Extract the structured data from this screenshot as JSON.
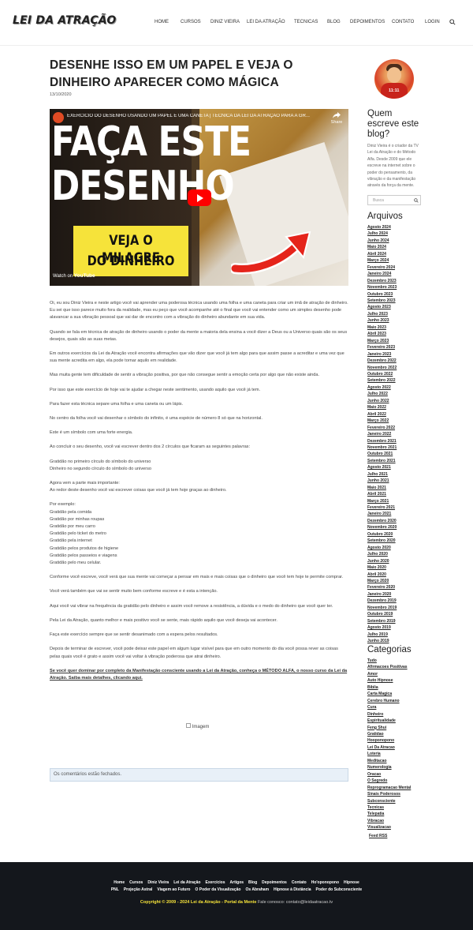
{
  "header": {
    "logo": "LEI DA ATRAÇÃO",
    "nav": [
      "Home",
      "CURSOS",
      "DINIZ VIEIRA",
      "LEI DA ATRAÇÃO",
      "TECNICAS",
      "BLOG",
      "DEPOIMENTOS",
      "CONTATO",
      "LOGIN"
    ]
  },
  "post": {
    "title": "DESENHE ISSO EM UM PAPEL E VEJA O DINHEIRO APARECER COMO MÁGICA",
    "date": "13/10/2020",
    "video": {
      "title": "EXERCÍCIO DO DESENHO USANDO UM PAPEL E UMA CANETA | TÉCNICA DA LEI DA ATRAÇÃO PARA A GR...",
      "share": "Share",
      "big_line1": "FAÇA ESTE",
      "big_line2": "DESENHO",
      "banner_line1": "VEJA O MILAGRE",
      "banner_line2": "DO DINHEIRO",
      "watch_on": "Watch on",
      "youtube": "YouTube"
    },
    "paragraphs": [
      "Oi, eu sou Diniz Vieira e neste artigo você vai aprender uma poderosa técnica usando uma folha e uma caneta para criar um imã de atração de dinheiro. Eu sei que isso parece muito fora da realidade, mas eu peço que você acompanhe até o final que você vai entender como um simples desenho pode alavancar a sua vibração pessoal que vai dar de encontro com a vibração do dinheiro abundante em sua vida.",
      "Quando se fala em técnica de atração de dinheiro usando o poder da mente a maioria dela ensina a você dizer a Deus ou a Universo quais são os seus desejos, quais são as suas metas.",
      "Em outros exercícios da Lei da Atração você encontra afirmações que vão dizer que você já tem algo para que assim passe a acreditar e uma vez que sua mente acredita em algo, ela pode tornar aquilo em realidade.",
      "Mas muita gente tem dificuldade de sentir a vibração positiva, por que não consegue sentir a emoção certa por algo que não existe ainda.",
      "Por isso que este exercício de hoje vai te ajudar a chegar neste sentimento, usando aquilo que você já tem.",
      "Para fazer esta técnica separe uma folha e uma caneta ou um lápis.",
      "No centro da folha você vai desenhar o símbolo do infinito, é uma espécie de número 8 só que na horizontal.",
      "Este é um símbolo com uma forte energia.",
      "Ao concluir o seu desenho, você vai escrever dentro dos 2 círculos que ficaram as seguintes palavras:"
    ],
    "words": [
      "Gratidão no primeiro círculo do símbolo do universo",
      "Dinheiro no segundo círculo do símbolo do universo"
    ],
    "important": [
      "Agora vem a parte mais importante:",
      "Ao redor deste desenho você vai escrever coisas que você já tem hoje graças ao dinheiro."
    ],
    "examples": [
      "Por exemplo:",
      "Gratidão pela comida",
      "Gratidão por minhas roupas",
      "Gratidão por meu carro",
      "Gratidão pelo ticket do metro",
      "Gratidão pela internet",
      "Gratidão pelos produtos de higiene",
      "Gratidão pelos passeios e viagens",
      "Gratidão pelo meu celular."
    ],
    "paragraphs2": [
      "Conforme você escreve, você verá que sua mente vai começar a pensar em mais e mais coisas que o dinheiro que você tem hoje te permite comprar.",
      "Você verá também que vai se sentir muito bem conforme escreve e é esta a intenção.",
      "Aqui você vai vibrar na frequência da gratidão pelo dinheiro e assim você remove a resistência, a dúvida e o medo do dinheiro que você quer ter.",
      "Pela Lei da Atração, quanto melhor e mais positivo você se sente, mais rápido aquilo que você deseja vai acontecer.",
      "Faça este exercício sempre que se sentir desanimado com a espera pelos resultados.",
      "Depois de terminar de escrever, você pode deixar este papel em algum lugar visível para que em outro momento do dia você possa rever as coisas pelas quais você é grato e assim você vai voltar à vibração poderosa que atrai dinheiro."
    ],
    "cta": "Se você quer dominar por completo da Manifestação consciente usando a Lei da Atração, conheça o MÉTODO ALFA, o nosso curso da Lei da Atração. Saiba mais detalhes, clicando aqui.",
    "image_alt": "Imagem",
    "comments_closed": "Os comentários estão fechados."
  },
  "sidebar": {
    "avatar_badge": "11:11",
    "who_title": "Quem escreve este blog?",
    "bio": "Diniz Vieira é o criador da TV Lei da Atração e do Método Alfa. Desde 2009 que ele escreve na internet sobre o poder do pensamento, da vibração e da manifestação através da força da mente.",
    "search_placeholder": "Busca",
    "archives_title": "Arquivos",
    "archives": [
      "Agosto 2024",
      "Julho 2024",
      "Junho 2024",
      "Maio 2024",
      "Abril 2024",
      "Março 2024",
      "Fevereiro 2024",
      "Janeiro 2024",
      "Dezembro 2023",
      "Novembro 2023",
      "Outubro 2023",
      "Setembro 2023",
      "Agosto 2023",
      "Julho 2023",
      "Junho 2023",
      "Maio 2023",
      "Abril 2023",
      "Março 2023",
      "Fevereiro 2023",
      "Janeiro 2023",
      "Dezembro 2022",
      "Novembro 2022",
      "Outubro 2022",
      "Setembro 2022",
      "Agosto 2022",
      "Julho 2022",
      "Junho 2022",
      "Maio 2022",
      "Abril 2022",
      "Março 2022",
      "Fevereiro 2022",
      "Janeiro 2022",
      "Dezembro 2021",
      "Novembro 2021",
      "Outubro 2021",
      "Setembro 2021",
      "Agosto 2021",
      "Julho 2021",
      "Junho 2021",
      "Maio 2021",
      "Abril 2021",
      "Março 2021",
      "Fevereiro 2021",
      "Janeiro 2021",
      "Dezembro 2020",
      "Novembro 2020",
      "Outubro 2020",
      "Setembro 2020",
      "Agosto 2020",
      "Julho 2020",
      "Junho 2020",
      "Maio 2020",
      "Abril 2020",
      "Março 2020",
      "Fevereiro 2020",
      "Janeiro 2020",
      "Dezembro 2019",
      "Novembro 2019",
      "Outubro 2019",
      "Setembro 2019",
      "Agosto 2019",
      "Julho 2019",
      "Junho 2019"
    ],
    "categories_title": "Categorias",
    "categories": [
      "Tudo",
      "Afirmacoes Positivas",
      "Amor",
      "Auto Hipnose",
      "Biblia",
      "Carta Magica",
      "Cerebro Humano",
      "Cura",
      "Dinheiro",
      "Espiritualidade",
      "Feng Shui",
      "Gratidao",
      "Hooponopono",
      "Lei Da Atracao",
      "Loteria",
      "Meditacao",
      "Numerologia",
      "Oracao",
      "O Segredo",
      "Reprogramacao Mental",
      "Sinais Poderosos",
      "Subconsciente",
      "Tecnicas",
      "Telepatia",
      "Vibracao",
      "Visualizacao"
    ],
    "feed": "Feed RSS"
  },
  "footer": {
    "row1": [
      "Home",
      "Cursos",
      "Diniz Vieira",
      "Lei da Atração",
      "Exercícios",
      "Artigos",
      "Blog",
      "Depoimentos",
      "Contato",
      "Ho'oponopono",
      "Hipnose"
    ],
    "row2": [
      "PNL",
      "Projeção Astral",
      "Viagem ao Futuro",
      "O Poder da Visualização",
      "Os Abraham",
      "Hipnose à Distância",
      "Poder do Subconsciente"
    ],
    "copyright": "Copyright © 2009 - 2024 Lei da Atração - Portal da Mente",
    "contact": "Fale conosco: contato@leidaatracao.tv"
  },
  "colors": {
    "accent_yellow": "#f6e33a",
    "footer_bg": "#14171c",
    "youtube_red": "#ff0000"
  }
}
